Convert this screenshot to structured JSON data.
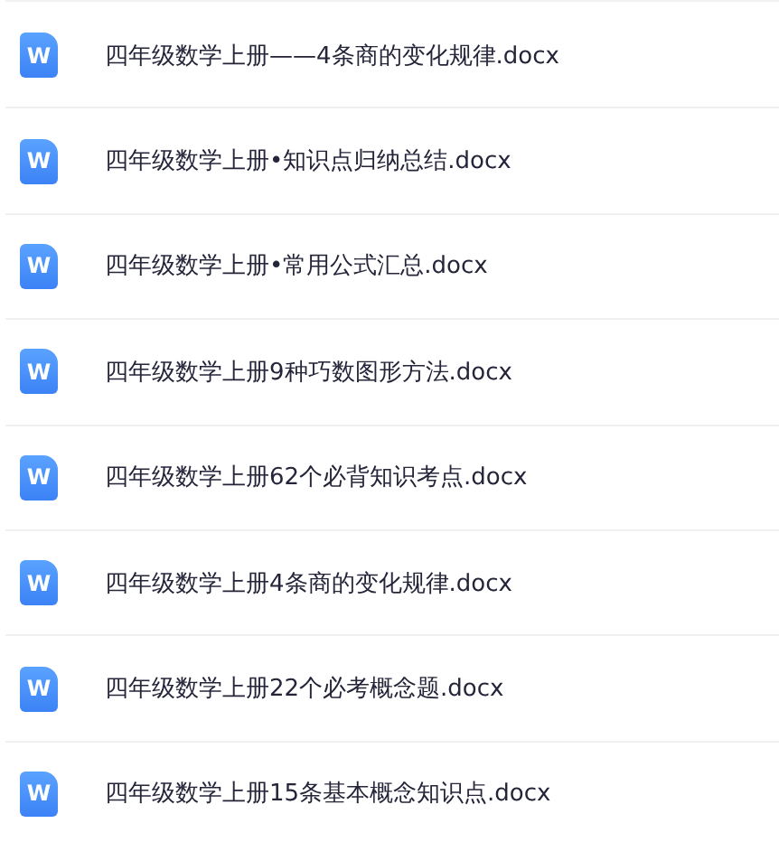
{
  "files": [
    {
      "icon_letter": "W",
      "name": "四年级数学上册——4条商的变化规律.docx"
    },
    {
      "icon_letter": "W",
      "name": "四年级数学上册•知识点归纳总结.docx"
    },
    {
      "icon_letter": "W",
      "name": "四年级数学上册•常用公式汇总.docx"
    },
    {
      "icon_letter": "W",
      "name": "四年级数学上册9种巧数图形方法.docx"
    },
    {
      "icon_letter": "W",
      "name": "四年级数学上册62个必背知识考点.docx"
    },
    {
      "icon_letter": "W",
      "name": "四年级数学上册4条商的变化规律.docx"
    },
    {
      "icon_letter": "W",
      "name": "四年级数学上册22个必考概念题.docx"
    },
    {
      "icon_letter": "W",
      "name": "四年级数学上册15条基本概念知识点.docx"
    }
  ]
}
